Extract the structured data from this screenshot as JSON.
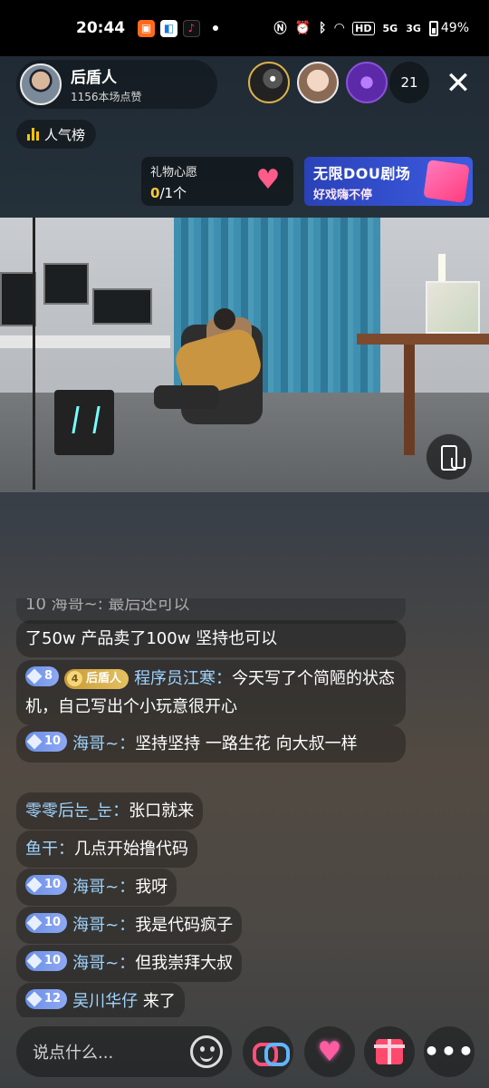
{
  "status_bar": {
    "time": "20:44",
    "network_labels": [
      "5G",
      "3G"
    ],
    "battery": "49%",
    "hd_label": "HD"
  },
  "host": {
    "name": "后盾人",
    "likes": "1156本场点赞"
  },
  "viewer_count": "21",
  "rank_label": "人气榜",
  "wish": {
    "title": "礼物心愿",
    "progress_current": "0",
    "progress_rest": "/1个"
  },
  "ad_banner": {
    "line1": "无限DOU剧场",
    "line2": "好戏嗨不停"
  },
  "chat": {
    "partial_prefix": "10  海哥~: 最后还可以",
    "messages": [
      {
        "level": "",
        "fan_badge": "",
        "fan_level": "",
        "user": "",
        "text": "了50w 产品卖了100w 坚持也可以"
      },
      {
        "level": "8",
        "fan_badge": "后盾人",
        "fan_level": "4",
        "user": "程序员江寒：",
        "text": "今天写了个简陋的状态机，自己写出个小玩意很开心"
      },
      {
        "level": "10",
        "fan_badge": "",
        "fan_level": "",
        "user": "海哥~：",
        "text": "坚持坚持 一路生花 向大叔一样"
      },
      {
        "level": "",
        "fan_badge": "",
        "fan_level": "",
        "user": "零零后눈_눈：",
        "text": "张口就来"
      },
      {
        "level": "",
        "fan_badge": "",
        "fan_level": "",
        "user": "鱼干：",
        "text": "几点开始撸代码"
      },
      {
        "level": "10",
        "fan_badge": "",
        "fan_level": "",
        "user": "海哥~：",
        "text": "我呀"
      },
      {
        "level": "10",
        "fan_badge": "",
        "fan_level": "",
        "user": "海哥~：",
        "text": "我是代码疯子"
      },
      {
        "level": "10",
        "fan_badge": "",
        "fan_level": "",
        "user": "海哥~：",
        "text": "但我崇拜大叔"
      },
      {
        "level": "12",
        "fan_badge": "",
        "fan_level": "",
        "user": "吴川华仔",
        "text": "来了"
      }
    ]
  },
  "comment_input": {
    "placeholder": "说点什么..."
  },
  "colors": {
    "username": "#9fd4ff",
    "level_badge": "#7a98ea",
    "fan_badge": "#d4aa48",
    "rank_bars": "#f5c400"
  }
}
